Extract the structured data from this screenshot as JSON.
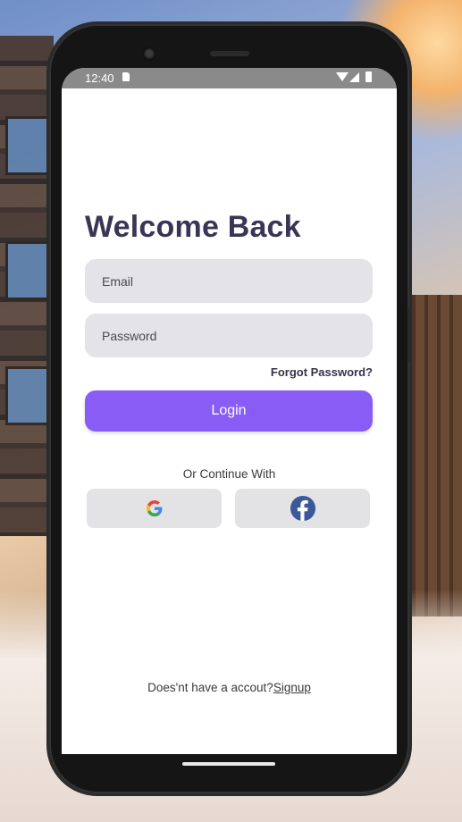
{
  "status_bar": {
    "time": "12:40"
  },
  "login": {
    "title": "Welcome Back",
    "email_placeholder": "Email",
    "password_placeholder": "Password",
    "forgot_password": "Forgot Password?",
    "login_button": "Login",
    "continue_text": "Or Continue With",
    "social": {
      "google_icon": "google-icon",
      "facebook_icon": "facebook-icon"
    },
    "signup_prompt": "Does'nt have a accout?",
    "signup_link": "Signup"
  },
  "colors": {
    "accent": "#8a5cf6",
    "title": "#3a3555",
    "field_bg": "#e4e4e8",
    "facebook_blue": "#3b5998"
  }
}
